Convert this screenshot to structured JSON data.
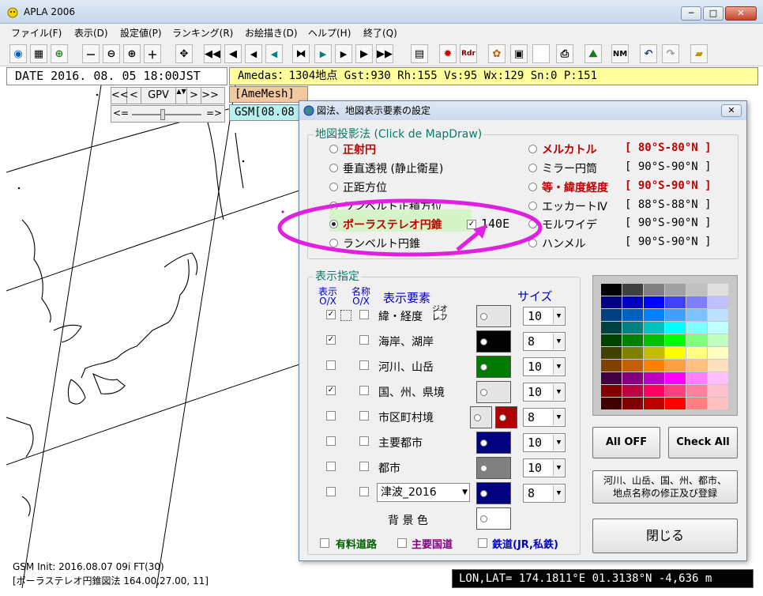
{
  "window": {
    "title": "APLA 2006",
    "min": "─",
    "max": "□",
    "close": "✕"
  },
  "menu": [
    "ファイル(F)",
    "表示(D)",
    "設定値(P)",
    "ランキング(R)",
    "お絵描き(D)",
    "ヘルプ(H)",
    "終了(Q)"
  ],
  "toolbar": {
    "rdr": "Rdr",
    "nm": "NM"
  },
  "info": {
    "date": "DATE 2016. 08. 05  18:00JST",
    "amedas": "Amedas：1304地点  Gst:930 Rh:155 Vs:95 Wx:129 Sn:0 P:151"
  },
  "gpv": {
    "first": "<<",
    "prev": "<",
    "label": "GPV",
    "next": ">",
    "last": ">>",
    "left": "<=",
    "right": "=>"
  },
  "tags": {
    "amemesh": "[AmeMesh]",
    "gsm": "GSM[08.08"
  },
  "status": {
    "line1": "GSM Init: 2016.08.07 09i FT(30)",
    "line2": "[ポーラステレオ円錐図法 164.00,27.00, 11]",
    "coords": "LON,LAT= 174.1811°E  01.3138°N  -4,636 m"
  },
  "dialog": {
    "title": "図法、地図表示要素の設定",
    "close": "✕",
    "projection_group": "地図投影法 (Click de MapDraw)",
    "projections_left": [
      {
        "label": "正射円",
        "bold": true,
        "selected": false
      },
      {
        "label": "垂直透視 (静止衛星)",
        "bold": false,
        "selected": false
      },
      {
        "label": "正距方位",
        "bold": false,
        "selected": false
      },
      {
        "label": "ランベルト正積方位",
        "bold": false,
        "selected": false
      },
      {
        "label": "ポーラステレオ円錐",
        "bold": true,
        "selected": true
      },
      {
        "label": "ランベルト円錐",
        "bold": false,
        "selected": false
      }
    ],
    "stereo_option": "140E",
    "projections_right": [
      {
        "label": "メルカトル",
        "range": "[ 80°S-80°N ]",
        "bold": true
      },
      {
        "label": "ミラー円筒",
        "range": "[ 90°S-90°N ]",
        "bold": false
      },
      {
        "label": "等・緯度経度",
        "range": "[ 90°S-90°N ]",
        "bold": true
      },
      {
        "label": "エッカートⅣ",
        "range": "[ 88°S-88°N ]",
        "bold": false
      },
      {
        "label": "モルワイデ",
        "range": "[ 90°S-90°N ]",
        "bold": false
      },
      {
        "label": "ハンメル",
        "range": "[ 90°S-90°N ]",
        "bold": false
      }
    ],
    "display_group": "表示指定",
    "hdr_show": "表示",
    "hdr_show2": "O/X",
    "hdr_name": "名称",
    "hdr_name2": "O/X",
    "hdr_element": "表示要素",
    "hdr_size": "サイズ",
    "geo_label": "ジオ",
    "geo_label2": "レフ",
    "rows": [
      {
        "label": "緯・経度",
        "show": true,
        "name": false,
        "color": "#e6e6e6",
        "size": "10"
      },
      {
        "label": "海岸、湖岸",
        "show": true,
        "name": false,
        "color": "#000000",
        "size": "8"
      },
      {
        "label": "河川、山岳",
        "show": false,
        "name": false,
        "color": "#007a00",
        "size": "10"
      },
      {
        "label": "国、州、県境",
        "show": true,
        "name": false,
        "color": "#e6e6e6",
        "size": "10"
      },
      {
        "label": "市区町村境",
        "show": false,
        "name": false,
        "color": "#b00000",
        "size": "8"
      },
      {
        "label": "主要都市",
        "show": false,
        "name": false,
        "color": "#000080",
        "size": "10"
      },
      {
        "label": "都市",
        "show": false,
        "name": false,
        "color": "#808080",
        "size": "10"
      },
      {
        "label": "津波_2016",
        "show": false,
        "name": false,
        "color": "#000080",
        "size": "8"
      }
    ],
    "bg_label": "背 景 色",
    "bottom_checks": [
      {
        "label": "有料道路",
        "color": "#006000"
      },
      {
        "label": "主要国道",
        "color": "#800080"
      },
      {
        "label": "鉄道(JR,私鉄)",
        "color": "#0000c0"
      }
    ],
    "all_off": "All OFF",
    "check_all": "Check All",
    "edit_line1": "河川、山岳、国、州、都市、",
    "edit_line2": "地点名称の修正及び登録",
    "close_btn": "閉じる"
  },
  "palette": [
    [
      "#000000",
      "#404040",
      "#808080",
      "#a0a0a0",
      "#c0c0c0",
      "#e0e0e0"
    ],
    [
      "#000080",
      "#0000c0",
      "#0000ff",
      "#4040ff",
      "#8080ff",
      "#c0c0ff"
    ],
    [
      "#004080",
      "#0060c0",
      "#0080ff",
      "#40a0ff",
      "#80c0ff",
      "#c0e0ff"
    ],
    [
      "#004040",
      "#008080",
      "#00c0c0",
      "#00ffff",
      "#80ffff",
      "#c0ffff"
    ],
    [
      "#004000",
      "#008000",
      "#00c000",
      "#00ff00",
      "#80ff80",
      "#c0ffc0"
    ],
    [
      "#404000",
      "#808000",
      "#c0c000",
      "#ffff00",
      "#ffff80",
      "#ffffc0"
    ],
    [
      "#804000",
      "#c06000",
      "#ff8000",
      "#ffa040",
      "#ffc080",
      "#ffe0c0"
    ],
    [
      "#400040",
      "#800080",
      "#c000c0",
      "#ff00ff",
      "#ff80ff",
      "#ffc0ff"
    ],
    [
      "#800000",
      "#c00040",
      "#ff0060",
      "#ff4080",
      "#ff80a0",
      "#ffc0d0"
    ],
    [
      "#400000",
      "#800000",
      "#c00000",
      "#ff0000",
      "#ff8080",
      "#ffc0c0"
    ]
  ]
}
